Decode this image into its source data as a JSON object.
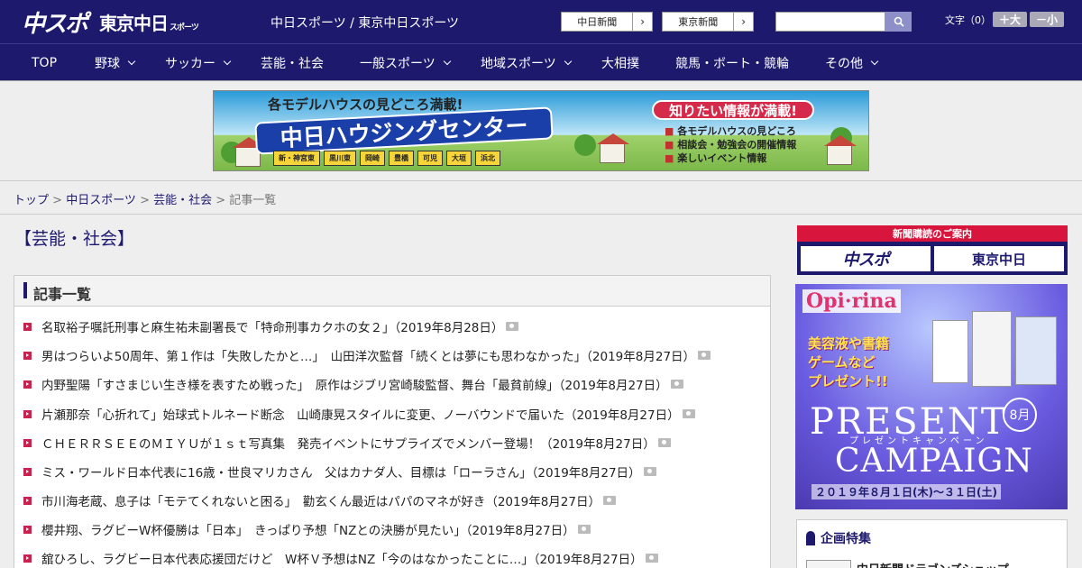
{
  "header": {
    "logo_chu": "中スポ",
    "logo_tokyo": "東京中日",
    "logo_tokyo_sub": "スポーツ",
    "site_title": "中日スポーツ / 東京中日スポーツ",
    "paper1": "中日新聞",
    "paper2": "東京新聞",
    "search_placeholder": "",
    "fontsize_label": "文字（0）",
    "fontsize_plus": "＋大",
    "fontsize_minus": "－小"
  },
  "nav": [
    {
      "label": "TOP"
    },
    {
      "label": "野球"
    },
    {
      "label": "サッカー"
    },
    {
      "label": "芸能・社会"
    },
    {
      "label": "一般スポーツ"
    },
    {
      "label": "地域スポーツ"
    },
    {
      "label": "大相撲"
    },
    {
      "label": "競馬・ボート・競輪"
    },
    {
      "label": "その他"
    }
  ],
  "banner": {
    "top": "各モデルハウスの見どころ満載!",
    "main": "中日ハウジングセンター",
    "cities": [
      "新・神宮東",
      "黒川東",
      "岡崎",
      "豊橋",
      "可児",
      "大垣",
      "浜北"
    ],
    "right_title": "知りたい情報が満載!",
    "list": [
      "各モデルハウスの見どころ",
      "相談会・勉強会の開催情報",
      "楽しいイベント情報"
    ]
  },
  "breadcrumb": {
    "items": [
      "トップ",
      "中日スポーツ",
      "芸能・社会"
    ],
    "current": "記事一覧",
    "sep": " > "
  },
  "page_heading": "【芸能・社会】",
  "list_title": "記事一覧",
  "articles": [
    "名取裕子嘱託刑事と麻生祐未副署長で「特命刑事カクホの女２」（2019年8月28日）",
    "男はつらいよ50周年、第１作は「失敗したかと…」　山田洋次監督「続くとは夢にも思わなかった」（2019年8月27日）",
    "内野聖陽「すさまじい生き様を表すため戦った」　原作はジブリ宮崎駿監督、舞台「最貧前線」（2019年8月27日）",
    "片瀬那奈「心折れて」始球式トルネード断念　山崎康晃スタイルに変更、ノーバウンドで届いた（2019年8月27日）",
    "ＣＨＥＲＲＳＥＥのＭＩＹＵが１ｓｔ写真集　発売イベントにサプライズでメンバー登場！（2019年8月27日）",
    "ミス・ワールド日本代表に16歳・世良マリカさん　父はカナダ人、目標は「ローラさん」（2019年8月27日）",
    "市川海老蔵、息子は「モテてくれないと困る」　勸玄くん最近はパパのマネが好き（2019年8月27日）",
    "櫻井翔、ラグビーW杯優勝は「日本」　きっぱり予想「NZとの決勝が見たい」（2019年8月27日）",
    "舘ひろし、ラグビー日本代表応援団だけど　W杯Ｖ予想はNZ「今のはなかったことに…」（2019年8月27日）"
  ],
  "sidebar": {
    "sub_head": "新聞購読のご案内",
    "sub_logo1": "中スポ",
    "sub_logo2": "東京中日",
    "ad_logo": "Opi·rina",
    "ad_text1": "美容液や書籍",
    "ad_text2": "ゲームなど",
    "ad_text3": "プレゼント!!",
    "ad_present": "PRESENT",
    "ad_sub": "プレゼントキャンペーン",
    "ad_campaign": "CAMPAIGN",
    "ad_month": "8月",
    "ad_date": "２０１９年８月１日(木)～３１日(土)",
    "feature_title": "企画特集",
    "feature_item": "中日新聞ドラゴンズショップ"
  },
  "colors": {
    "brand": "#1d1a6e",
    "accent": "#c8234e"
  }
}
